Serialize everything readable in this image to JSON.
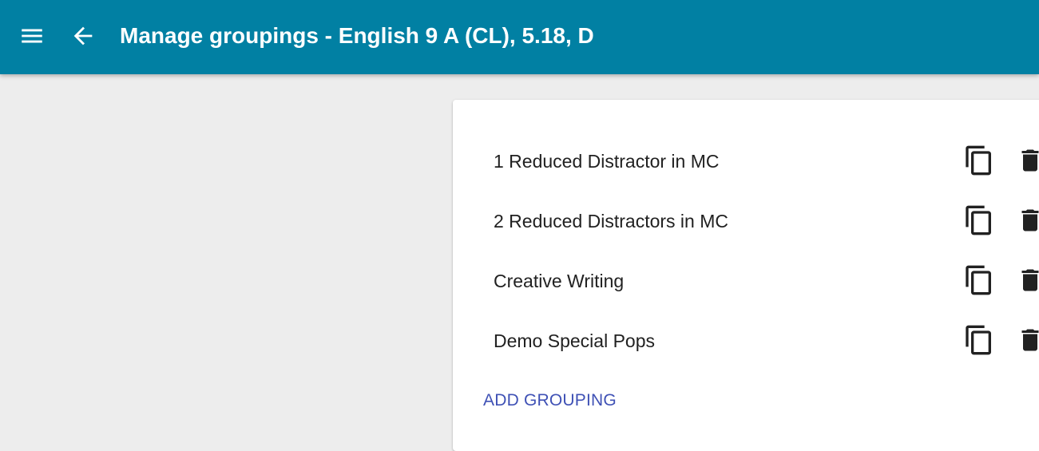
{
  "appbar": {
    "menu_icon": "menu-icon",
    "back_icon": "arrow-back-icon",
    "title": "Manage groupings - English 9 A (CL), 5.18, D"
  },
  "groupings": [
    {
      "label": "1 Reduced Distractor in MC",
      "copy_icon": "copy-icon",
      "delete_icon": "delete-icon"
    },
    {
      "label": "2 Reduced Distractors in MC",
      "copy_icon": "copy-icon",
      "delete_icon": "delete-icon"
    },
    {
      "label": "Creative Writing",
      "copy_icon": "copy-icon",
      "delete_icon": "delete-icon"
    },
    {
      "label": "Demo Special Pops",
      "copy_icon": "copy-icon",
      "delete_icon": "delete-icon"
    }
  ],
  "add_grouping_label": "ADD GROUPING",
  "colors": {
    "appbar": "#0180a3",
    "background": "#ededed",
    "accent": "#3f51b5",
    "text": "#212121"
  }
}
